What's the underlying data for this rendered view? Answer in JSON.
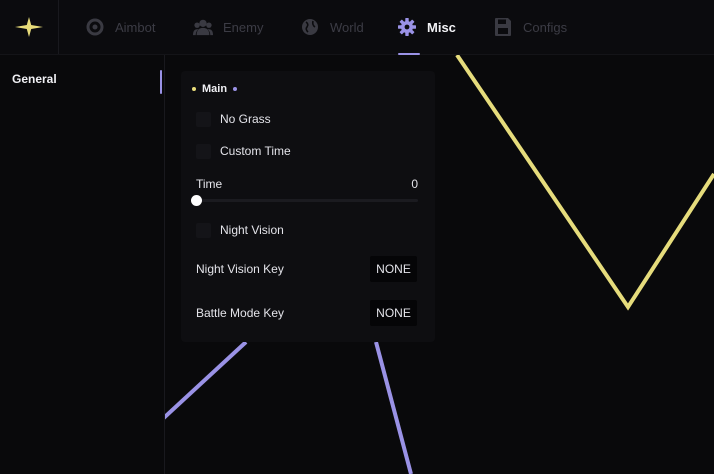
{
  "colors": {
    "accent": "#9a92e6",
    "logo_yellow": "#e8dc7a",
    "line_yellow": "#e6dc7c",
    "line_purple": "#9a92e6",
    "background": "#09090b",
    "panel": "#0e0e11"
  },
  "header": {
    "logo_icon": "sparkle-star-icon",
    "tabs": [
      {
        "label": "Aimbot",
        "icon": "crosshair-icon",
        "active": false
      },
      {
        "label": "Enemy",
        "icon": "users-icon",
        "active": false
      },
      {
        "label": "World",
        "icon": "globe-icon",
        "active": false
      },
      {
        "label": "Misc",
        "icon": "gear-icon",
        "active": true
      },
      {
        "label": "Configs",
        "icon": "save-icon",
        "active": false
      }
    ]
  },
  "sidebar": {
    "items": [
      {
        "label": "General",
        "active": true
      }
    ]
  },
  "panel": {
    "title": "Main",
    "options": {
      "no_grass": {
        "label": "No Grass",
        "checked": false
      },
      "custom_time": {
        "label": "Custom Time",
        "checked": false
      },
      "night_vision": {
        "label": "Night Vision",
        "checked": false
      }
    },
    "time_slider": {
      "label": "Time",
      "value": "0",
      "fraction": 0.0
    },
    "night_vision_key": {
      "label": "Night Vision Key",
      "value": "NONE"
    },
    "battle_mode_key": {
      "label": "Battle Mode Key",
      "value": "NONE"
    }
  }
}
